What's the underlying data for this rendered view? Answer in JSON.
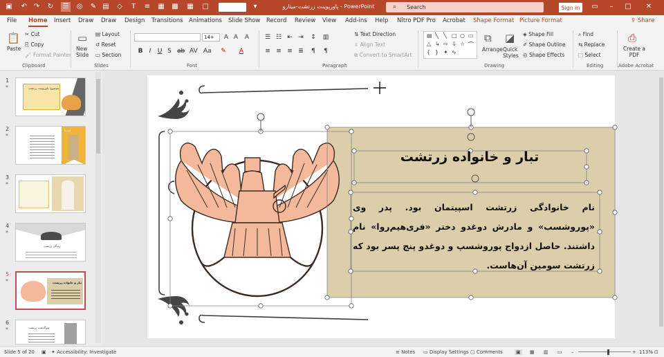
{
  "window": {
    "title": "پاورپوینت زرتشت-میتارو  -  PowerPoint",
    "search_placeholder": "Search",
    "sign_in": "Sign in",
    "accent": "#b7472a"
  },
  "tabs": [
    "File",
    "Home",
    "Insert",
    "Draw",
    "Draw",
    "Design",
    "Transitions",
    "Animations",
    "Slide Show",
    "Record",
    "Review",
    "View",
    "Add-ins",
    "Help",
    "Nitro PDF Pro",
    "Acrobat",
    "Shape Format",
    "Picture Format"
  ],
  "active_tab": "Home",
  "share_label": "Share",
  "ribbon": {
    "clipboard": {
      "paste": "Paste",
      "cut": "Cut",
      "copy": "Copy",
      "format_painter": "Format Painter",
      "label": "Clipboard"
    },
    "slides": {
      "new_slide": "New Slide",
      "layout": "Layout",
      "reset": "Reset",
      "section": "Section",
      "label": "Slides"
    },
    "font": {
      "name": "",
      "size": "14+",
      "label": "Font"
    },
    "paragraph": {
      "text_direction": "Text Direction",
      "align_text": "Align Text",
      "convert_smartart": "Convert to SmartArt",
      "label": "Paragraph"
    },
    "drawing": {
      "arrange": "Arrange",
      "quick_styles": "Quick Styles",
      "shape_fill": "Shape Fill",
      "shape_outline": "Shape Outline",
      "shape_effects": "Shape Effects",
      "label": "Drawing"
    },
    "editing": {
      "find": "Find",
      "replace": "Replace",
      "select": "Select",
      "label": "Editing"
    },
    "adobe": {
      "create_pdf": "Create a PDF",
      "label": "Adobe Acrobat"
    }
  },
  "thumbnails": [
    {
      "num": "1",
      "caption": "موضوع: پاورپوینت زرتشت"
    },
    {
      "num": "2",
      "caption": "اوستا"
    },
    {
      "num": "3",
      "caption": ""
    },
    {
      "num": "4",
      "caption": "زندگی زرتشت"
    },
    {
      "num": "5",
      "caption": "تبار و خانواده زرتشت"
    },
    {
      "num": "6",
      "caption": "سرگذشت زرتشت"
    }
  ],
  "selected_slide": "5",
  "slide": {
    "title": "تبار و خانواده زرتشت",
    "body": "نام خانوادگی زرتشت اسپیتمان بود. پدر وی «پوروشسب» و مادرش دوغدو دختر «فری‌هیم‌روا» نام داشتند. حاصل ازدواج پوروشسپ و دوغدو پنج پسر بود که زرتشت سومین آن‌هاست.",
    "panel_color": "#dccdab",
    "emblem_color": "#f4b99a"
  },
  "status": {
    "slide_of": "Slide 5 of 20",
    "accessibility": "Accessibility: Investigate",
    "notes": "Notes",
    "display_settings": "Display Settings",
    "comments": "Comments",
    "zoom": "113%"
  }
}
